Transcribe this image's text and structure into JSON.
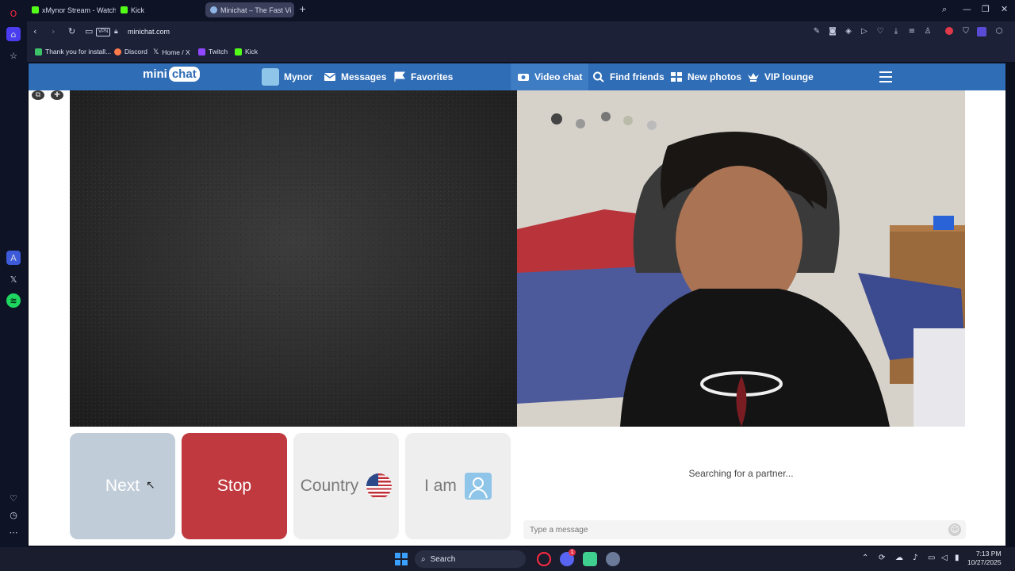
{
  "browser": {
    "tabs": [
      {
        "label": "xMynor Stream - Watch Li",
        "active": false
      },
      {
        "label": "Kick",
        "active": false
      },
      {
        "label": "Minichat – The Fast Vi",
        "active": true
      }
    ],
    "new_tab": "+",
    "url": "minichat.com",
    "vpn": "VPN",
    "bookmarks": [
      "Thank you for install...",
      "Discord",
      "Home / X",
      "Twitch",
      "Kick"
    ]
  },
  "site": {
    "logo_mini": "mini",
    "logo_chat": "chat",
    "nav": {
      "profile": "Mynor",
      "messages": "Messages",
      "favorites": "Favorites",
      "video_chat": "Video chat",
      "find_friends": "Find friends",
      "new_photos": "New photos",
      "vip": "VIP lounge"
    },
    "controls": {
      "next": "Next",
      "stop": "Stop",
      "country": "Country",
      "iam": "I am"
    },
    "status": "Searching for a partner...",
    "message_placeholder": "Type a message"
  },
  "taskbar": {
    "search": "Search",
    "time": "7:13 PM",
    "date": "10/27/2025",
    "discord_badge": "1"
  },
  "colors": {
    "header": "#2f6db6",
    "stop": "#c0393e",
    "next": "#c1ccd9"
  }
}
